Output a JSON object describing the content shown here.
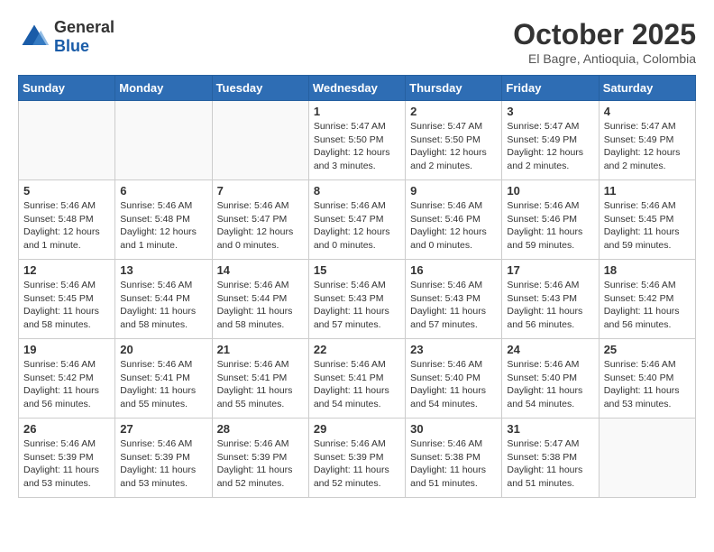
{
  "header": {
    "logo_general": "General",
    "logo_blue": "Blue",
    "title": "October 2025",
    "location": "El Bagre, Antioquia, Colombia"
  },
  "weekdays": [
    "Sunday",
    "Monday",
    "Tuesday",
    "Wednesday",
    "Thursday",
    "Friday",
    "Saturday"
  ],
  "weeks": [
    [
      {
        "day": "",
        "info": ""
      },
      {
        "day": "",
        "info": ""
      },
      {
        "day": "",
        "info": ""
      },
      {
        "day": "1",
        "info": "Sunrise: 5:47 AM\nSunset: 5:50 PM\nDaylight: 12 hours and 3 minutes."
      },
      {
        "day": "2",
        "info": "Sunrise: 5:47 AM\nSunset: 5:50 PM\nDaylight: 12 hours and 2 minutes."
      },
      {
        "day": "3",
        "info": "Sunrise: 5:47 AM\nSunset: 5:49 PM\nDaylight: 12 hours and 2 minutes."
      },
      {
        "day": "4",
        "info": "Sunrise: 5:47 AM\nSunset: 5:49 PM\nDaylight: 12 hours and 2 minutes."
      }
    ],
    [
      {
        "day": "5",
        "info": "Sunrise: 5:46 AM\nSunset: 5:48 PM\nDaylight: 12 hours and 1 minute."
      },
      {
        "day": "6",
        "info": "Sunrise: 5:46 AM\nSunset: 5:48 PM\nDaylight: 12 hours and 1 minute."
      },
      {
        "day": "7",
        "info": "Sunrise: 5:46 AM\nSunset: 5:47 PM\nDaylight: 12 hours and 0 minutes."
      },
      {
        "day": "8",
        "info": "Sunrise: 5:46 AM\nSunset: 5:47 PM\nDaylight: 12 hours and 0 minutes."
      },
      {
        "day": "9",
        "info": "Sunrise: 5:46 AM\nSunset: 5:46 PM\nDaylight: 12 hours and 0 minutes."
      },
      {
        "day": "10",
        "info": "Sunrise: 5:46 AM\nSunset: 5:46 PM\nDaylight: 11 hours and 59 minutes."
      },
      {
        "day": "11",
        "info": "Sunrise: 5:46 AM\nSunset: 5:45 PM\nDaylight: 11 hours and 59 minutes."
      }
    ],
    [
      {
        "day": "12",
        "info": "Sunrise: 5:46 AM\nSunset: 5:45 PM\nDaylight: 11 hours and 58 minutes."
      },
      {
        "day": "13",
        "info": "Sunrise: 5:46 AM\nSunset: 5:44 PM\nDaylight: 11 hours and 58 minutes."
      },
      {
        "day": "14",
        "info": "Sunrise: 5:46 AM\nSunset: 5:44 PM\nDaylight: 11 hours and 58 minutes."
      },
      {
        "day": "15",
        "info": "Sunrise: 5:46 AM\nSunset: 5:43 PM\nDaylight: 11 hours and 57 minutes."
      },
      {
        "day": "16",
        "info": "Sunrise: 5:46 AM\nSunset: 5:43 PM\nDaylight: 11 hours and 57 minutes."
      },
      {
        "day": "17",
        "info": "Sunrise: 5:46 AM\nSunset: 5:43 PM\nDaylight: 11 hours and 56 minutes."
      },
      {
        "day": "18",
        "info": "Sunrise: 5:46 AM\nSunset: 5:42 PM\nDaylight: 11 hours and 56 minutes."
      }
    ],
    [
      {
        "day": "19",
        "info": "Sunrise: 5:46 AM\nSunset: 5:42 PM\nDaylight: 11 hours and 56 minutes."
      },
      {
        "day": "20",
        "info": "Sunrise: 5:46 AM\nSunset: 5:41 PM\nDaylight: 11 hours and 55 minutes."
      },
      {
        "day": "21",
        "info": "Sunrise: 5:46 AM\nSunset: 5:41 PM\nDaylight: 11 hours and 55 minutes."
      },
      {
        "day": "22",
        "info": "Sunrise: 5:46 AM\nSunset: 5:41 PM\nDaylight: 11 hours and 54 minutes."
      },
      {
        "day": "23",
        "info": "Sunrise: 5:46 AM\nSunset: 5:40 PM\nDaylight: 11 hours and 54 minutes."
      },
      {
        "day": "24",
        "info": "Sunrise: 5:46 AM\nSunset: 5:40 PM\nDaylight: 11 hours and 54 minutes."
      },
      {
        "day": "25",
        "info": "Sunrise: 5:46 AM\nSunset: 5:40 PM\nDaylight: 11 hours and 53 minutes."
      }
    ],
    [
      {
        "day": "26",
        "info": "Sunrise: 5:46 AM\nSunset: 5:39 PM\nDaylight: 11 hours and 53 minutes."
      },
      {
        "day": "27",
        "info": "Sunrise: 5:46 AM\nSunset: 5:39 PM\nDaylight: 11 hours and 53 minutes."
      },
      {
        "day": "28",
        "info": "Sunrise: 5:46 AM\nSunset: 5:39 PM\nDaylight: 11 hours and 52 minutes."
      },
      {
        "day": "29",
        "info": "Sunrise: 5:46 AM\nSunset: 5:39 PM\nDaylight: 11 hours and 52 minutes."
      },
      {
        "day": "30",
        "info": "Sunrise: 5:46 AM\nSunset: 5:38 PM\nDaylight: 11 hours and 51 minutes."
      },
      {
        "day": "31",
        "info": "Sunrise: 5:47 AM\nSunset: 5:38 PM\nDaylight: 11 hours and 51 minutes."
      },
      {
        "day": "",
        "info": ""
      }
    ]
  ]
}
